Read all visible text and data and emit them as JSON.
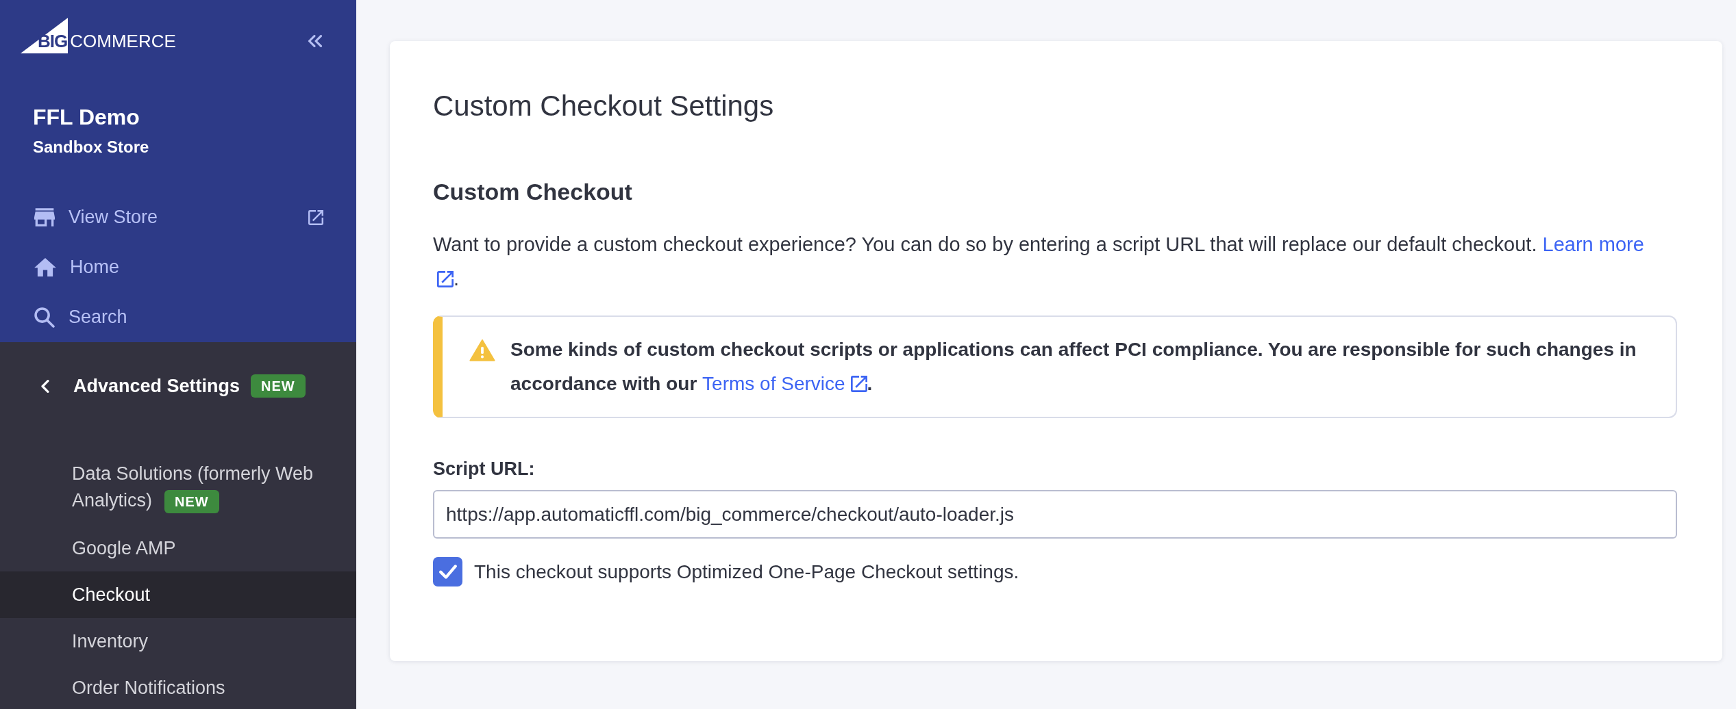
{
  "sidebar": {
    "logo": {
      "prefix": "BIG",
      "name": "COMMERCE"
    },
    "store": {
      "name": "FFL Demo",
      "subtitle": "Sandbox Store"
    },
    "top_items": [
      {
        "label": "View Store",
        "kind": "store",
        "external": true
      },
      {
        "label": "Home",
        "kind": "home",
        "external": false
      },
      {
        "label": "Search",
        "kind": "search",
        "external": false
      }
    ],
    "section": {
      "title": "Advanced Settings",
      "badge": "NEW"
    },
    "items": [
      {
        "label": "Data Solutions (formerly Web Analytics)",
        "badge": "NEW",
        "selected": false
      },
      {
        "label": "Google AMP",
        "selected": false
      },
      {
        "label": "Checkout",
        "selected": true
      },
      {
        "label": "Inventory",
        "selected": false
      },
      {
        "label": "Order Notifications",
        "selected": false
      }
    ]
  },
  "page": {
    "title": "Custom Checkout Settings",
    "section_title": "Custom Checkout",
    "description": {
      "text": "Want to provide a custom checkout experience? You can do so by entering a script URL that will replace our default checkout.",
      "link": "Learn more",
      "after": "."
    },
    "warning": {
      "text": "Some kinds of custom checkout scripts or applications can affect PCI compliance. You are responsible for such changes in accordance with our",
      "link": "Terms of Service",
      "after": "."
    },
    "script_url": {
      "label": "Script URL:",
      "value": "https://app.automaticffl.com/big_commerce/checkout/auto-loader.js"
    },
    "checkbox": {
      "label": "This checkout supports Optimized One-Page Checkout settings.",
      "checked": true
    }
  }
}
